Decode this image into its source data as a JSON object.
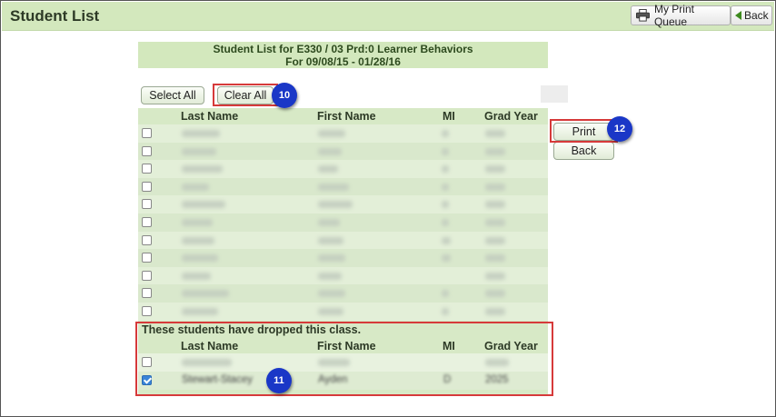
{
  "header": {
    "title": "Student List",
    "print_queue_label": "My Print Queue",
    "back_label": "Back"
  },
  "report": {
    "line1": "Student List for E330 / 03 Prd:0 Learner Behaviors",
    "line2": "For 09/08/15 - 01/28/16"
  },
  "actions": {
    "select_all": "Select All",
    "clear_all": "Clear All",
    "print": "Print",
    "back": "Back"
  },
  "table": {
    "columns": [
      "Last Name",
      "First Name",
      "MI",
      "Grad Year"
    ],
    "row_count": 11
  },
  "dropped": {
    "caption": "These students have dropped this class.",
    "columns": [
      "Last Name",
      "First Name",
      "MI",
      "Grad Year"
    ],
    "rows": [
      {
        "last": "",
        "first": "",
        "mi": "",
        "grad": "",
        "checked": false
      },
      {
        "last": "Stewart-Stacey",
        "first": "Ayden",
        "mi": "D",
        "grad": "2025",
        "checked": true
      }
    ]
  },
  "annotations": {
    "badge_clear": "10",
    "badge_dropped": "11",
    "badge_print": "12"
  },
  "colors": {
    "header_bg": "#d3e8bd",
    "table_bg": "#d7e9c6",
    "highlight": "#d63a3a",
    "badge": "#1a37c7"
  }
}
